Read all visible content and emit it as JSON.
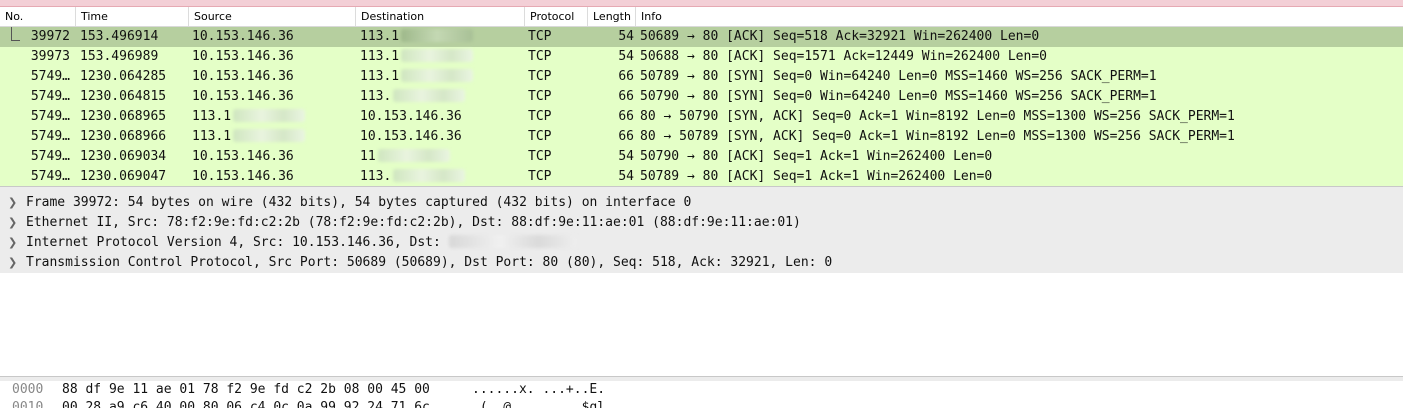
{
  "columns": [
    "No.",
    "Time",
    "Source",
    "Destination",
    "Protocol",
    "Length",
    "Info"
  ],
  "packets": [
    {
      "no": "39972",
      "time": "153.496914",
      "source": "10.153.146.36",
      "destination": "113.1",
      "protocol": "TCP",
      "length": "54",
      "info": "50689 → 80 [ACK] Seq=518 Ack=32921 Win=262400 Len=0",
      "selected": true
    },
    {
      "no": "39973",
      "time": "153.496989",
      "source": "10.153.146.36",
      "destination": "113.1",
      "protocol": "TCP",
      "length": "54",
      "info": "50688 → 80 [ACK] Seq=1571 Ack=12449 Win=262400 Len=0"
    },
    {
      "no": "5749…",
      "time": "1230.064285",
      "source": "10.153.146.36",
      "destination": "113.1",
      "protocol": "TCP",
      "length": "66",
      "info": "50789 → 80 [SYN] Seq=0 Win=64240 Len=0 MSS=1460 WS=256 SACK_PERM=1"
    },
    {
      "no": "5749…",
      "time": "1230.064815",
      "source": "10.153.146.36",
      "destination": "113.",
      "protocol": "TCP",
      "length": "66",
      "info": "50790 → 80 [SYN] Seq=0 Win=64240 Len=0 MSS=1460 WS=256 SACK_PERM=1"
    },
    {
      "no": "5749…",
      "time": "1230.068965",
      "source": "113.1",
      "destination": "10.153.146.36",
      "protocol": "TCP",
      "length": "66",
      "info": "80 → 50790 [SYN, ACK] Seq=0 Ack=1 Win=8192 Len=0 MSS=1300 WS=256 SACK_PERM=1"
    },
    {
      "no": "5749…",
      "time": "1230.068966",
      "source": "113.1",
      "destination": "10.153.146.36",
      "protocol": "TCP",
      "length": "66",
      "info": "80 → 50789 [SYN, ACK] Seq=0 Ack=1 Win=8192 Len=0 MSS=1300 WS=256 SACK_PERM=1"
    },
    {
      "no": "5749…",
      "time": "1230.069034",
      "source": "10.153.146.36",
      "destination": "11",
      "protocol": "TCP",
      "length": "54",
      "info": "50790 → 80 [ACK] Seq=1 Ack=1 Win=262400 Len=0"
    },
    {
      "no": "5749…",
      "time": "1230.069047",
      "source": "10.153.146.36",
      "destination": "113.",
      "protocol": "TCP",
      "length": "54",
      "info": "50789 → 80 [ACK] Seq=1 Ack=1 Win=262400 Len=0"
    }
  ],
  "details": [
    "Frame 39972: 54 bytes on wire (432 bits), 54 bytes captured (432 bits) on interface 0",
    "Ethernet II, Src: 78:f2:9e:fd:c2:2b (78:f2:9e:fd:c2:2b), Dst: 88:df:9e:11:ae:01 (88:df:9e:11:ae:01)",
    "Internet Protocol Version 4, Src: 10.153.146.36, Dst: ",
    "Transmission Control Protocol, Src Port: 50689 (50689), Dst Port: 80 (80), Seq: 518, Ack: 32921, Len: 0"
  ],
  "bytes": [
    {
      "offset": "0000",
      "hex": "88 df 9e 11 ae 01 78 f2  9e fd c2 2b 08 00 45 00",
      "ascii": "......x. ...+..E."
    },
    {
      "offset": "0010",
      "hex": "00 28 a9 c6 40 00 80 06  c4 0c 0a 99 92 24 71 6c",
      "ascii": ".(..@... .....$ql"
    }
  ],
  "colors": {
    "row_bg": "#e4ffc7",
    "selected_bg": "#b6cf9f",
    "detail_bg": "#ececec"
  }
}
